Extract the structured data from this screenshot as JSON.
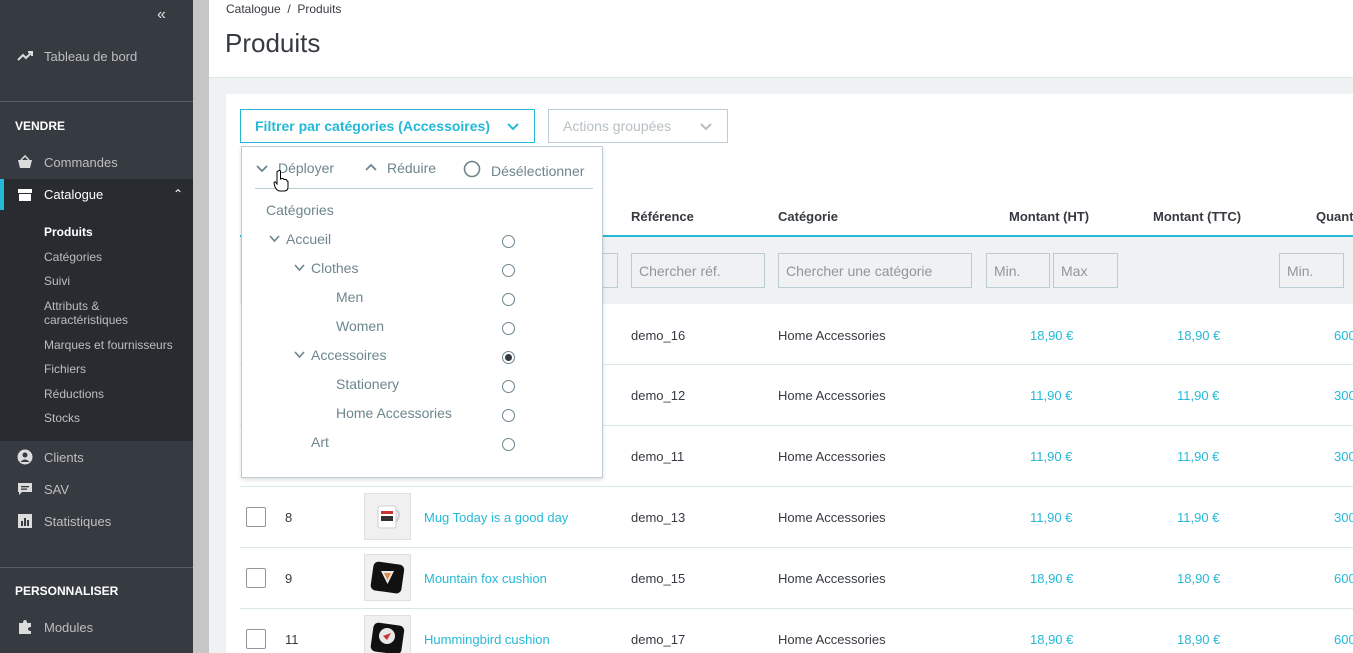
{
  "sidebar": {
    "dashboard": "Tableau de bord",
    "section_sell": "VENDRE",
    "orders": "Commandes",
    "catalog": "Catalogue",
    "catalog_sub": [
      "Produits",
      "Catégories",
      "Suivi",
      "Attributs &",
      "caractéristiques",
      "Marques et fournisseurs",
      "Fichiers",
      "Réductions",
      "Stocks"
    ],
    "customers": "Clients",
    "service": "SAV",
    "stats": "Statistiques",
    "section_customize": "PERSONNALISER",
    "modules": "Modules"
  },
  "header": {
    "breadcrumb": "Catalogue  /  Produits",
    "title": "Produits"
  },
  "toolbar": {
    "filter_label": "Filtrer par catégories (Accessoires)",
    "bulk_label": "Actions groupées"
  },
  "dropdown": {
    "expand": "Déployer",
    "collapse": "Réduire",
    "unselect": "Désélectionner",
    "heading": "Catégories",
    "tree": [
      "Accueil",
      "Clothes",
      "Men",
      "Women",
      "Accessoires",
      "Stationery",
      "Home Accessories",
      "Art"
    ],
    "selected": "Accessoires"
  },
  "table": {
    "headers": {
      "reference": "Référence",
      "category": "Catégorie",
      "price_ht": "Montant (HT)",
      "price_ttc": "Montant (TTC)",
      "quantity": "Quant"
    },
    "filters": {
      "reference": "Chercher réf.",
      "category": "Chercher une catégorie",
      "min": "Min.",
      "max": "Max",
      "qty_min": "Min."
    },
    "rows": [
      {
        "id": "",
        "name": "",
        "ref": "demo_16",
        "category": "Home Accessories",
        "ht": "18,90 €",
        "ttc": "18,90 €",
        "qty": "600"
      },
      {
        "id": "",
        "name": "",
        "ref": "demo_12",
        "category": "Home Accessories",
        "ht": "11,90 €",
        "ttc": "11,90 €",
        "qty": "300"
      },
      {
        "id": "",
        "name": "",
        "ref": "demo_11",
        "category": "Home Accessories",
        "ht": "11,90 €",
        "ttc": "11,90 €",
        "qty": "300"
      },
      {
        "id": "8",
        "name": "Mug Today is a good day",
        "ref": "demo_13",
        "category": "Home Accessories",
        "ht": "11,90 €",
        "ttc": "11,90 €",
        "qty": "300"
      },
      {
        "id": "9",
        "name": "Mountain fox cushion",
        "ref": "demo_15",
        "category": "Home Accessories",
        "ht": "18,90 €",
        "ttc": "18,90 €",
        "qty": "600"
      },
      {
        "id": "11",
        "name": "Hummingbird cushion",
        "ref": "demo_17",
        "category": "Home Accessories",
        "ht": "18,90 €",
        "ttc": "18,90 €",
        "qty": "600"
      }
    ]
  },
  "colors": {
    "accent": "#25b9d7",
    "sidebar_bg": "#363a41",
    "text": "#363a41"
  }
}
